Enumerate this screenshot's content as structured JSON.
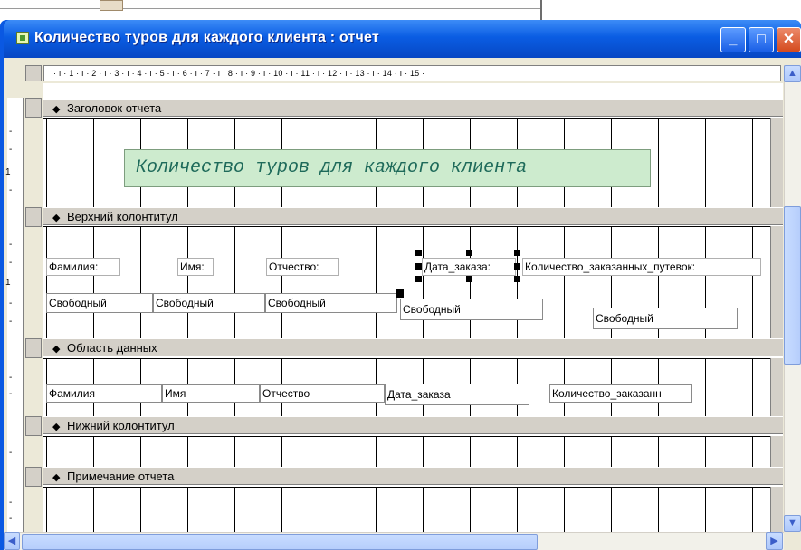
{
  "window": {
    "title": "Количество туров для каждого клиента : отчет",
    "min_glyph": "_",
    "max_glyph": "□",
    "close_glyph": "✕"
  },
  "ruler": {
    "text": "· ı · 1 · ı · 2 · ı · 3 · ı · 4 · ı · 5 · ı · 6 · ı · 7 · ı · 8 · ı · 9 · ı · 10 · ı · 11 · ı · 12 · ı · 13 · ı · 14 · ı · 15 ·"
  },
  "vruler": {
    "mark": "1"
  },
  "sections": {
    "report_header": "Заголовок отчета",
    "page_header": "Верхний колонтитул",
    "detail": "Область данных",
    "page_footer": "Нижний колонтитул",
    "report_footer": "Примечание отчета"
  },
  "report_header": {
    "title": "Количество туров для каждого клиента"
  },
  "page_header": {
    "labels": {
      "surname": "Фамилия:",
      "name": "Имя:",
      "patronymic": "Отчество:",
      "order_date": "Дата_заказа:",
      "vouchers": "Количество_заказанных_путевок:"
    },
    "free": [
      "Свободный",
      "Свободный",
      "Свободный",
      "Свободный",
      "Свободный"
    ]
  },
  "detail": {
    "surname": "Фамилия",
    "name": "Имя",
    "patronymic": "Отчество",
    "order_date": "Дата_заказа",
    "vouchers": "Количество_заказанн"
  },
  "colors": {
    "title_bar": "#0a5de3",
    "section_bar": "#d4d0c8",
    "title_label_bg": "#cdebce",
    "title_label_text": "#1e6a5a"
  },
  "icons": {
    "arrow": "◆",
    "up": "▲",
    "down": "▼",
    "left": "◀",
    "right": "▶"
  }
}
